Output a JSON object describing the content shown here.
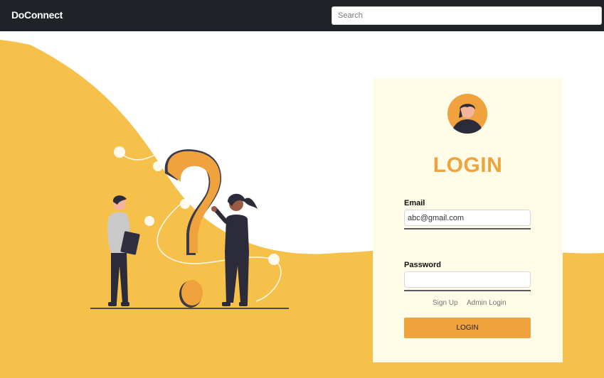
{
  "navbar": {
    "brand": "DoConnect",
    "search_placeholder": "Search"
  },
  "login_card": {
    "title": "LOGIN",
    "email_label": "Email",
    "email_value": "abc@gmail.com",
    "password_label": "Password",
    "password_value": "",
    "signup_link": "Sign Up",
    "admin_login_link": "Admin Login",
    "submit_label": "LOGIN"
  },
  "colors": {
    "navbar_bg": "#1f2226",
    "accent_orange": "#f0a23e",
    "hero_yellow": "#f5c14b",
    "card_bg": "#fefbe6"
  },
  "icons": {
    "avatar": "user-avatar-icon",
    "illustration": "question-mark-people-illustration"
  }
}
